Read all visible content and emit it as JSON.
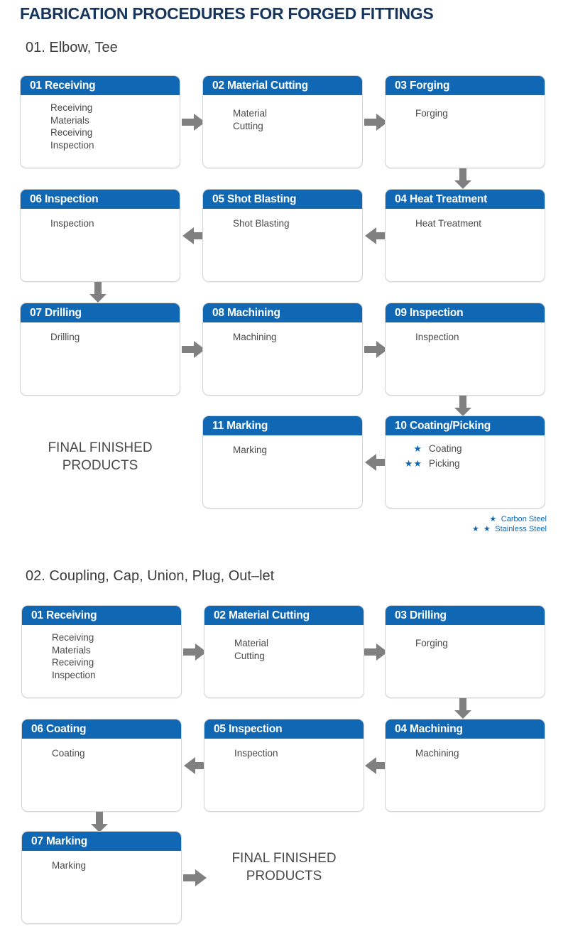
{
  "title": "FABRICATION PROCEDURES FOR FORGED FITTINGS",
  "colors": {
    "title_navy": "#17365D",
    "header_blue": "#1068B4",
    "arrow_gray": "#808080",
    "body_text": "#4a4a4a",
    "star_blue": "#1068B4"
  },
  "sections": [
    {
      "number": "01.",
      "name": "Elbow, Tee",
      "heading": "01.  Elbow, Tee",
      "final_products": "FINAL FINISHED\nPRODUCTS",
      "boxes": [
        {
          "id": "s1-01",
          "header": "01 Receiving",
          "lines": [
            "Receiving",
            "Materials",
            "Receiving",
            "Inspection"
          ]
        },
        {
          "id": "s1-02",
          "header": "02 Material Cutting",
          "lines": [
            "Material",
            "Cutting"
          ]
        },
        {
          "id": "s1-03",
          "header": "03 Forging",
          "lines": [
            "Forging"
          ]
        },
        {
          "id": "s1-04",
          "header": "04 Heat Treatment",
          "lines": [
            "Heat Treatment"
          ]
        },
        {
          "id": "s1-05",
          "header": "05 Shot Blasting",
          "lines": [
            "Shot Blasting"
          ]
        },
        {
          "id": "s1-06",
          "header": "06 Inspection",
          "lines": [
            "Inspection"
          ]
        },
        {
          "id": "s1-07",
          "header": "07 Drilling",
          "lines": [
            "Drilling"
          ]
        },
        {
          "id": "s1-08",
          "header": "08 Machining",
          "lines": [
            "Machining"
          ]
        },
        {
          "id": "s1-09",
          "header": "09 Inspection",
          "lines": [
            "Inspection"
          ]
        },
        {
          "id": "s1-10",
          "header": "10 Coating/Picking",
          "lines": [],
          "star_lines": [
            {
              "stars": "★",
              "text": "Coating"
            },
            {
              "stars": "★★",
              "text": "Picking"
            }
          ]
        },
        {
          "id": "s1-11",
          "header": "11 Marking",
          "lines": [
            "Marking"
          ]
        }
      ],
      "legend": [
        {
          "stars": "★",
          "label": "Carbon Steel"
        },
        {
          "stars": "★ ★",
          "label": "Stainless Steel"
        }
      ]
    },
    {
      "number": "02.",
      "name": "Coupling, Cap, Union, Plug, Out-let",
      "heading": "02.  Coupling, Cap, Union, Plug, Out–let",
      "final_products": "FINAL FINISHED\nPRODUCTS",
      "boxes": [
        {
          "id": "s2-01",
          "header": "01 Receiving",
          "lines": [
            "Receiving",
            "Materials",
            "Receiving",
            "Inspection"
          ]
        },
        {
          "id": "s2-02",
          "header": "02 Material Cutting",
          "lines": [
            "Material",
            "Cutting"
          ]
        },
        {
          "id": "s2-03",
          "header": "03 Drilling",
          "lines": [
            "Forging"
          ]
        },
        {
          "id": "s2-04",
          "header": "04 Machining",
          "lines": [
            "Machining"
          ]
        },
        {
          "id": "s2-05",
          "header": "05 Inspection",
          "lines": [
            "Inspection"
          ]
        },
        {
          "id": "s2-06",
          "header": "06 Coating",
          "lines": [
            "Coating"
          ]
        },
        {
          "id": "s2-07",
          "header": "07 Marking",
          "lines": [
            "Marking"
          ]
        }
      ]
    }
  ],
  "arrows": {
    "right": "arrow-right-icon",
    "left": "arrow-left-icon",
    "down": "arrow-down-icon"
  }
}
